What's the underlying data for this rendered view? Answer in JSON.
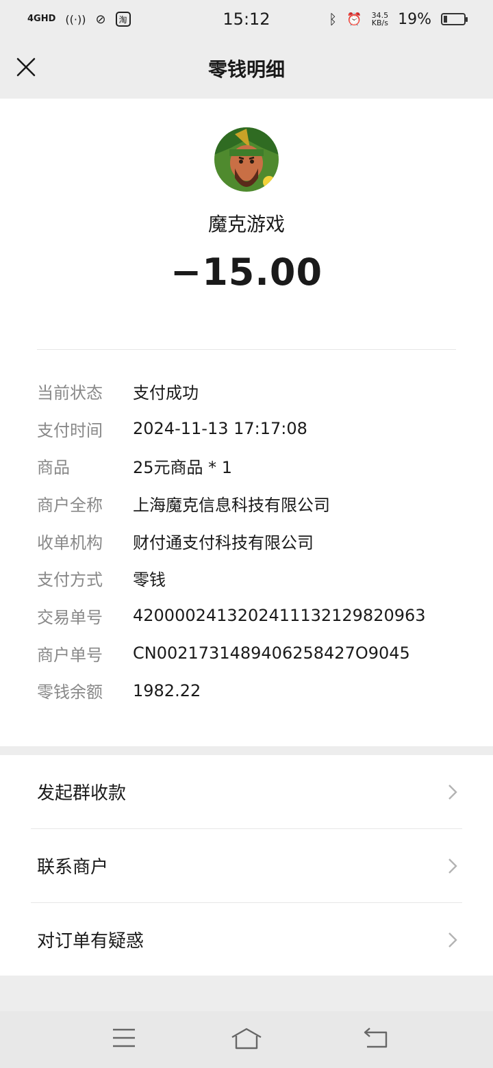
{
  "status_bar": {
    "network": "4GHD",
    "time": "15:12",
    "net_speed_value": "34.5",
    "net_speed_unit": "KB/s",
    "battery": "19%",
    "battery_level": 0.19
  },
  "header": {
    "title": "零钱明细"
  },
  "merchant": {
    "name": "魔克游戏",
    "amount": "−15.00"
  },
  "details": [
    {
      "label": "当前状态",
      "value": "支付成功"
    },
    {
      "label": "支付时间",
      "value": "2024-11-13 17:17:08"
    },
    {
      "label": "商品",
      "value": "25元商品 * 1"
    },
    {
      "label": "商户全称",
      "value": "上海魔克信息科技有限公司"
    },
    {
      "label": "收单机构",
      "value": "财付通支付科技有限公司"
    },
    {
      "label": "支付方式",
      "value": "零钱"
    },
    {
      "label": "交易单号",
      "value": "4200002413202411132129820963"
    },
    {
      "label": "商户单号",
      "value": "CN0021731489406258427O9045"
    },
    {
      "label": "零钱余额",
      "value": "1982.22"
    }
  ],
  "actions": [
    {
      "label": "发起群收款"
    },
    {
      "label": "联系商户"
    },
    {
      "label": "对订单有疑惑"
    }
  ]
}
